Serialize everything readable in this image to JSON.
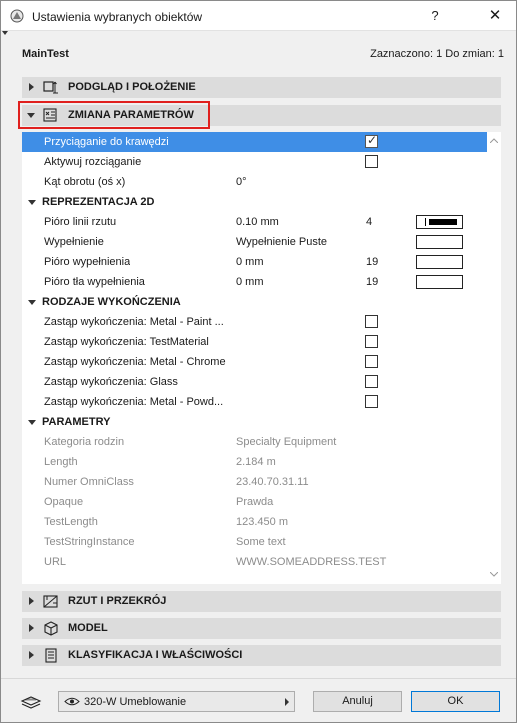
{
  "window": {
    "title": "Ustawienia wybranych obiektów",
    "help": "?",
    "close": "✕"
  },
  "info": {
    "element_name": "MainTest",
    "selection": "Zaznaczono: 1 Do zmian: 1"
  },
  "sections": {
    "preview": "PODGLĄD I POŁOŻENIE",
    "params": "ZMIANA PARAMETRÓW",
    "floorplan": "RZUT I PRZEKRÓJ",
    "model": "MODEL",
    "classification": "KLASYFIKACJA I WŁAŚCIWOŚCI"
  },
  "rows": {
    "snap": {
      "label": "Przyciąganie do krawędzi",
      "checked": true
    },
    "stretch": {
      "label": "Aktywuj rozciąganie",
      "checked": false
    },
    "angle": {
      "label": "Kąt obrotu (oś x)",
      "value": "0°"
    }
  },
  "repr2d": {
    "title": "REPREZENTACJA 2D",
    "items": [
      {
        "label": "Pióro linii rzutu",
        "value": "0.10 mm",
        "pen": "4"
      },
      {
        "label": "Wypełnienie",
        "value": "Wypełnienie Puste",
        "pen": ""
      },
      {
        "label": "Pióro wypełnienia",
        "value": "0 mm",
        "pen": "19"
      },
      {
        "label": "Pióro tła wypełnienia",
        "value": "0 mm",
        "pen": "19"
      }
    ]
  },
  "finishes": {
    "title": "RODZAJE WYKOŃCZENIA",
    "items": [
      {
        "label": "Zastąp wykończenia: Metal - Paint ...",
        "checked": false
      },
      {
        "label": "Zastąp wykończenia: TestMaterial",
        "checked": false
      },
      {
        "label": "Zastąp wykończenia: Metal - Chrome",
        "checked": false
      },
      {
        "label": "Zastąp wykończenia: Glass",
        "checked": false
      },
      {
        "label": "Zastąp wykończenia: Metal - Powd...",
        "checked": false
      }
    ]
  },
  "parameters": {
    "title": "PARAMETRY",
    "items": [
      {
        "label": "Kategoria rodzin",
        "value": "Specialty Equipment"
      },
      {
        "label": "Length",
        "value": "2.184 m"
      },
      {
        "label": "Numer OmniClass",
        "value": "23.40.70.31.11"
      },
      {
        "label": "Opaque",
        "value": "Prawda"
      },
      {
        "label": "TestLength",
        "value": "123.450 m"
      },
      {
        "label": "TestStringInstance",
        "value": "Some text"
      },
      {
        "label": "URL",
        "value": "WWW.SOMEADDRESS.TEST"
      }
    ]
  },
  "footer": {
    "layer": "320-W Umeblowanie",
    "cancel": "Anuluj",
    "ok": "OK"
  },
  "colors": {
    "selection": "#3f8ee6",
    "highlight_box": "#e0201e",
    "ok_border": "#0078d7"
  }
}
